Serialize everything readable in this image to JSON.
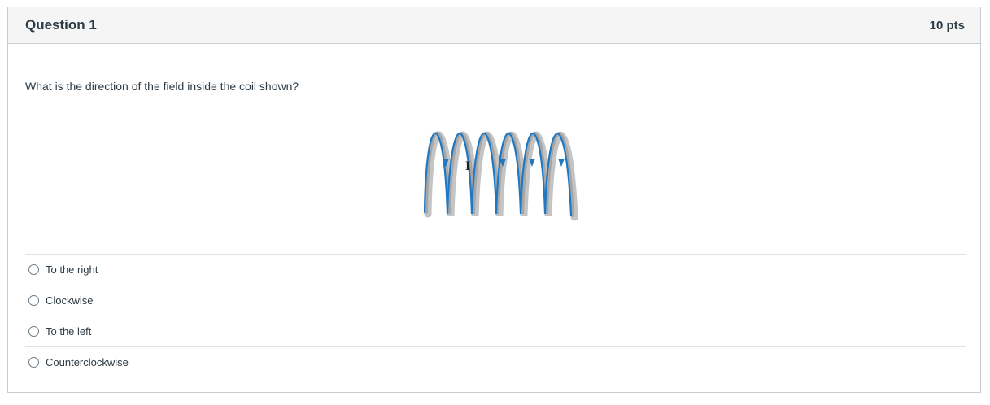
{
  "question": {
    "title": "Question 1",
    "points": "10 pts",
    "text": "What is the direction of the field inside the coil shown?",
    "figure_label": "I"
  },
  "answers": [
    {
      "label": "To the right"
    },
    {
      "label": "Clockwise"
    },
    {
      "label": "To the left"
    },
    {
      "label": "Counterclockwise"
    }
  ],
  "colors": {
    "coil_wire": "#1f78c1",
    "coil_shadow": "#b9b9b9",
    "header_bg": "#f5f5f5",
    "border": "#c7cdd1"
  }
}
